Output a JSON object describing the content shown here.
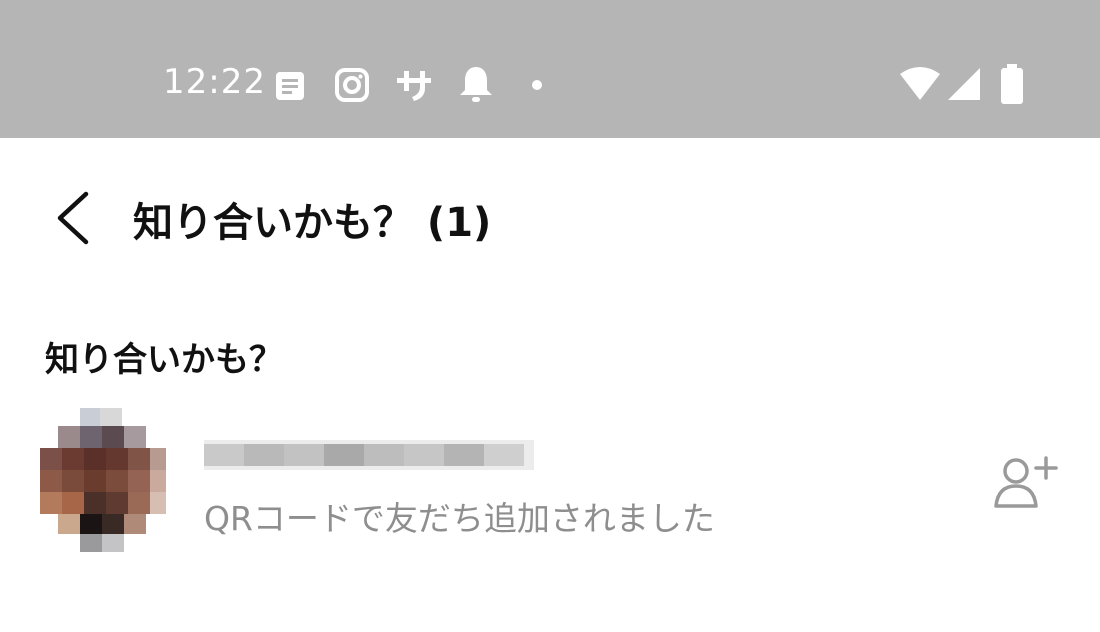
{
  "status_bar": {
    "time": "12:22",
    "left_icons": [
      "notes-icon",
      "instagram-icon",
      "app-glyph-icon",
      "bell-icon",
      "dot-icon"
    ],
    "right_icons": [
      "wifi-icon",
      "cellular-signal-icon",
      "battery-icon"
    ]
  },
  "header": {
    "back_icon": "chevron-left-icon",
    "title": "知り合いかも？ (1)"
  },
  "section": {
    "title": "知り合いかも？"
  },
  "friend": {
    "avatar": "pixelated-avatar",
    "name": "",
    "subtitle": "QRコードで友だち追加されました",
    "action_icon": "add-friend-icon"
  },
  "colors": {
    "status_bar_bg": "#b5b5b5",
    "title_text": "#111111",
    "subtext": "#8e8e8e",
    "icon_gray": "#9a9a9a"
  }
}
